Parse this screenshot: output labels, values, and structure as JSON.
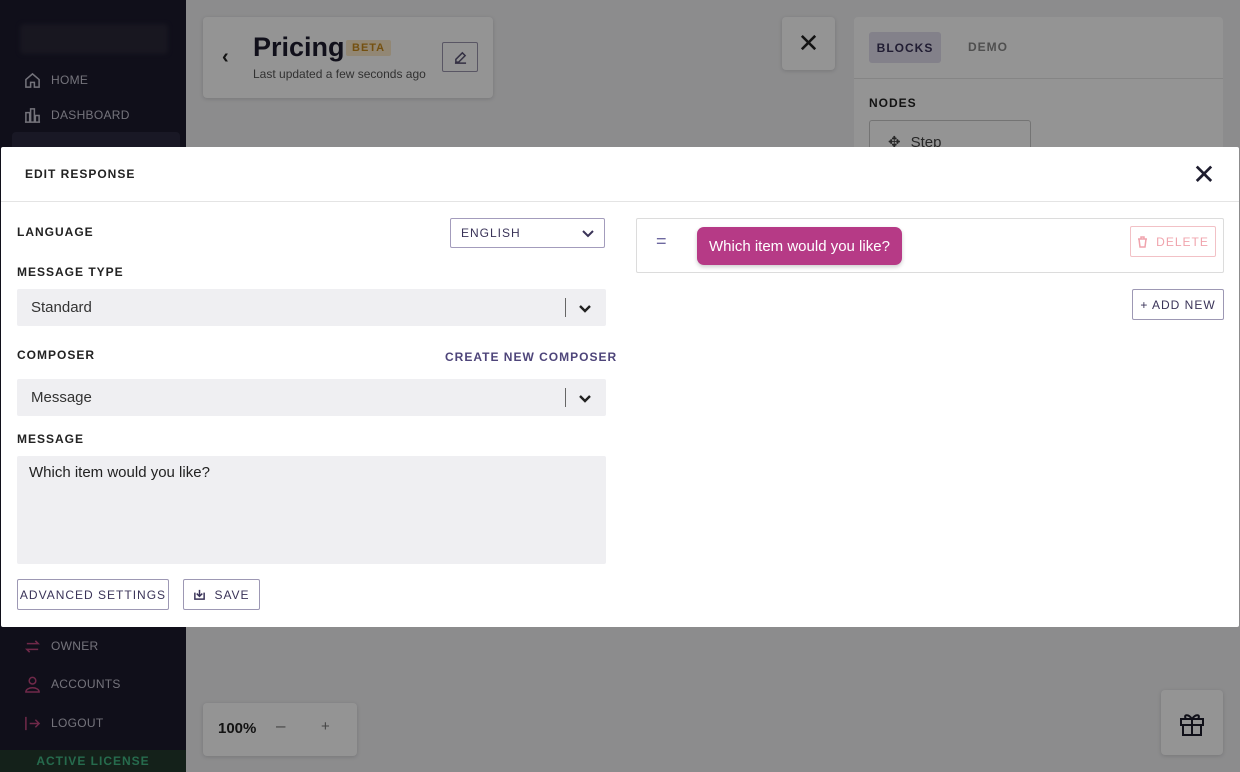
{
  "sidebar": {
    "items": [
      {
        "label": "HOME",
        "icon": "home-icon"
      },
      {
        "label": "DASHBOARD",
        "icon": "dashboard-icon"
      },
      {
        "label": "OWNER",
        "icon": "swap-icon"
      },
      {
        "label": "ACCOUNTS",
        "icon": "user-icon"
      },
      {
        "label": "LOGOUT",
        "icon": "logout-icon"
      }
    ],
    "license": "ACTIVE LICENSE"
  },
  "header": {
    "title": "Pricing",
    "badge": "BETA",
    "updated": "Last updated a few seconds ago"
  },
  "right_panel": {
    "tabs": [
      {
        "label": "BLOCKS",
        "active": true
      },
      {
        "label": "DEMO",
        "active": false
      }
    ],
    "nodes_label": "NODES",
    "node_step": "Step"
  },
  "zoom": {
    "level": "100%",
    "minus": "–",
    "plus": "+"
  },
  "modal": {
    "title": "EDIT RESPONSE",
    "close_icon": "×",
    "language": {
      "label": "LANGUAGE",
      "value": "ENGLISH"
    },
    "message_type": {
      "label": "MESSAGE TYPE",
      "value": "Standard"
    },
    "composer": {
      "label": "COMPOSER",
      "value": "Message",
      "create_link": "CREATE NEW COMPOSER"
    },
    "message": {
      "label": "MESSAGE",
      "value": "Which item would you like?"
    },
    "buttons": {
      "advanced": "ADVANCED SETTINGS",
      "save": "SAVE"
    },
    "preview": {
      "handle": "=",
      "bubble_text": "Which item would you like?",
      "delete": "DELETE",
      "add_new": "+ ADD NEW"
    }
  },
  "colors": {
    "accent": "#b63a86",
    "primary_text": "#3a3358",
    "sidebar_bg": "#1c1a2e",
    "license_green": "#43b886",
    "delete_pink": "#f0a4ad"
  }
}
